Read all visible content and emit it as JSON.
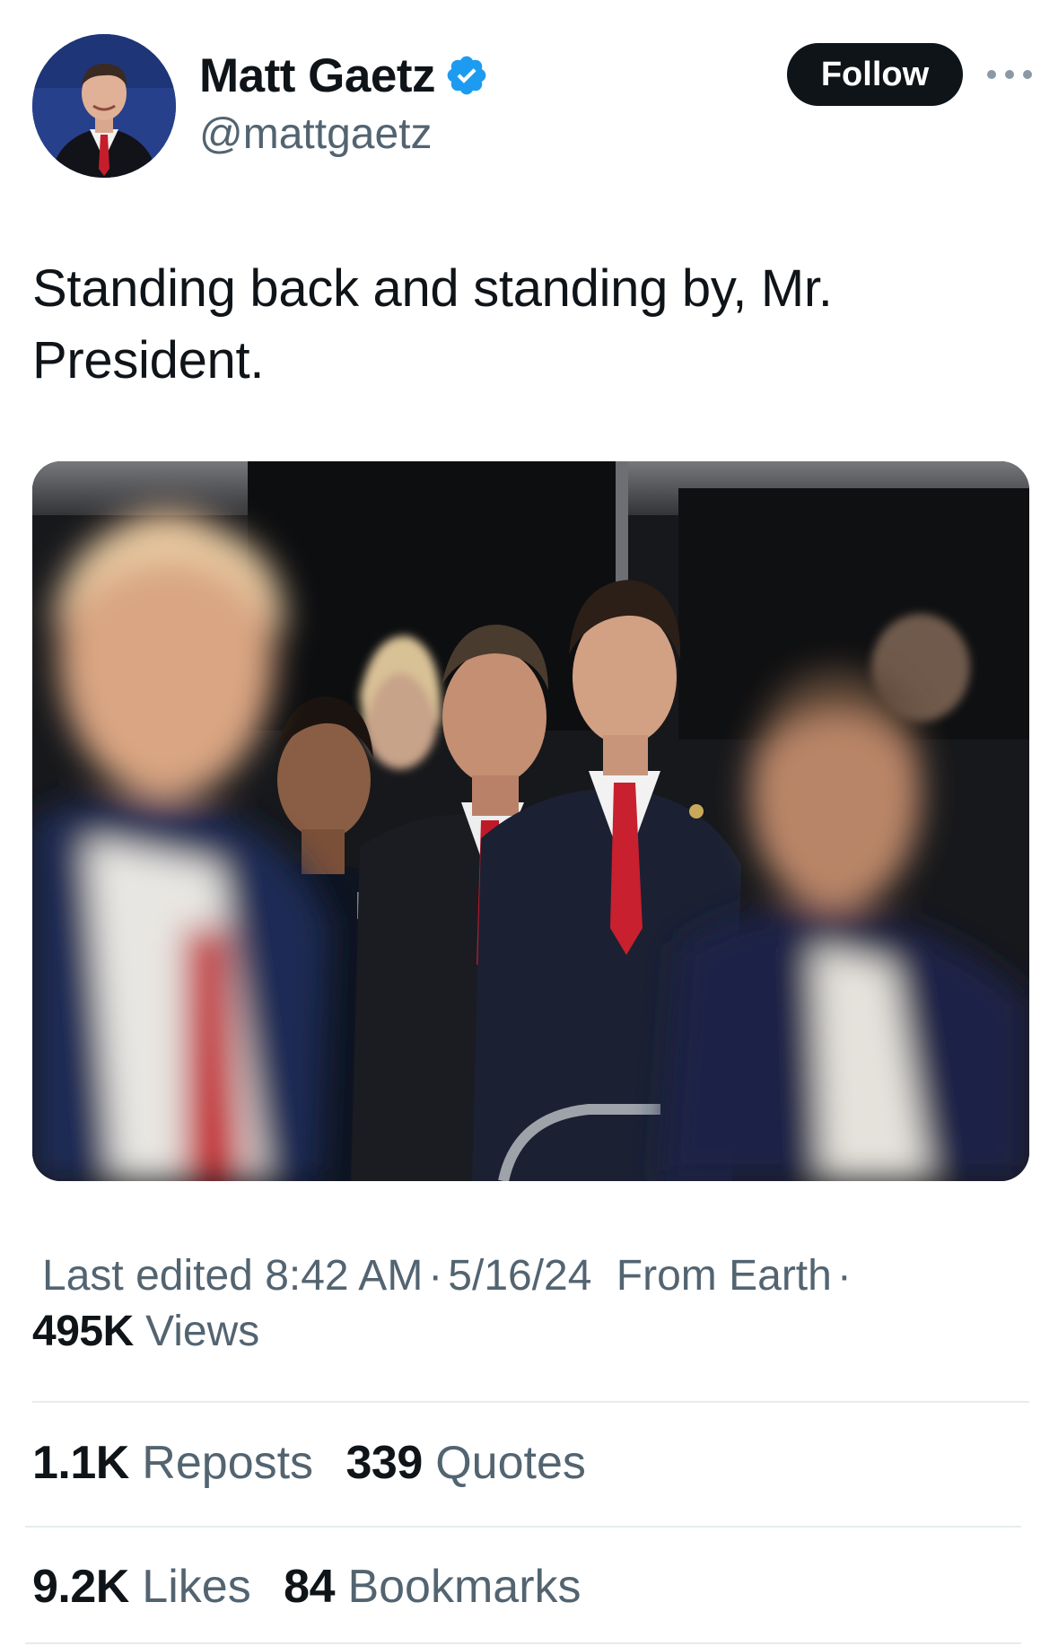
{
  "author": {
    "name": "Matt Gaetz",
    "handle": "@mattgaetz",
    "verified_badge_icon": "verified-badge-icon",
    "verified_color": "#1d9bf0"
  },
  "header": {
    "follow_label": "Follow",
    "more_icon": "more-options-icon"
  },
  "tweet": {
    "text": "Standing back and standing by, Mr. President."
  },
  "meta": {
    "edited_label": "Last edited",
    "time": "8:42 AM",
    "date": "5/16/24",
    "source": "From Earth",
    "separator": "·"
  },
  "stats": {
    "views_count": "495K",
    "views_label": "Views",
    "reposts_count": "1.1K",
    "reposts_label": "Reposts",
    "quotes_count": "339",
    "quotes_label": "Quotes",
    "likes_count": "9.2K",
    "likes_label": "Likes",
    "bookmarks_count": "84",
    "bookmarks_label": "Bookmarks"
  },
  "colors": {
    "text_primary": "#0f1419",
    "text_secondary": "#536471",
    "follow_bg": "#0f1419",
    "divider": "#e6ecf0"
  }
}
